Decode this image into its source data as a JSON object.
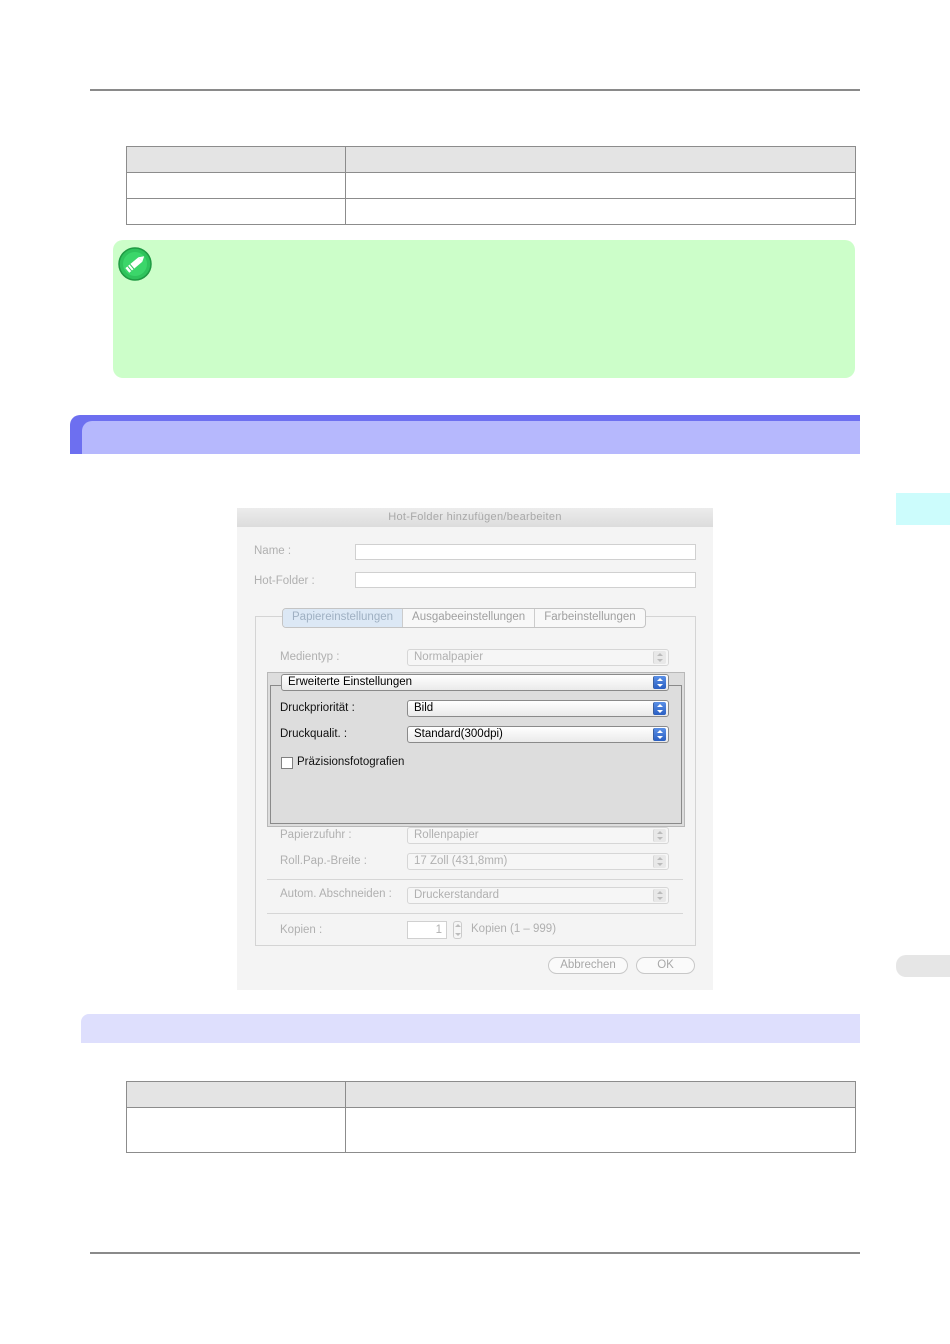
{
  "colors": {
    "note_bg": "#ccfec9",
    "section_bar": "#6d6ff0",
    "section_bar_inner": "#b6b8fd",
    "subsection_bar": "#dedffd",
    "side_tab": "#ccfcfc",
    "side_tab_gray": "#e6e6e6"
  },
  "note": {
    "icon": "note-pencil-icon"
  },
  "dialog": {
    "title": "Hot-Folder hinzufügen/bearbeiten",
    "name_label": "Name :",
    "name_value": "",
    "hotfolder_label": "Hot-Folder :",
    "hotfolder_value": "",
    "tabs": [
      {
        "label": "Papiereinstellungen",
        "active": true
      },
      {
        "label": "Ausgabeeinstellungen",
        "active": false
      },
      {
        "label": "Farbeinstellungen",
        "active": false
      }
    ],
    "medientyp_label": "Medientyp :",
    "medientyp_value": "Normalpapier",
    "advanced_select": "Erweiterte Einstellungen",
    "druckprioritaet_label": "Druckpriorität :",
    "druckprioritaet_value": "Bild",
    "druckqualitaet_label": "Druckqualit. :",
    "druckqualitaet_value": "Standard(300dpi)",
    "praezision_label": "Präzisionsfotografien",
    "praezision_checked": false,
    "papierzufuhr_label": "Papierzufuhr :",
    "papierzufuhr_value": "Rollenpapier",
    "rollpap_label": "Roll.Pap.-Breite :",
    "rollpap_value": "17 Zoll (431,8mm)",
    "autom_label": "Autom. Abschneiden :",
    "autom_value": "Druckerstandard",
    "kopien_label": "Kopien :",
    "kopien_value": "1",
    "kopien_range": "Kopien (1 – 999)",
    "cancel_label": "Abbrechen",
    "ok_label": "OK"
  }
}
